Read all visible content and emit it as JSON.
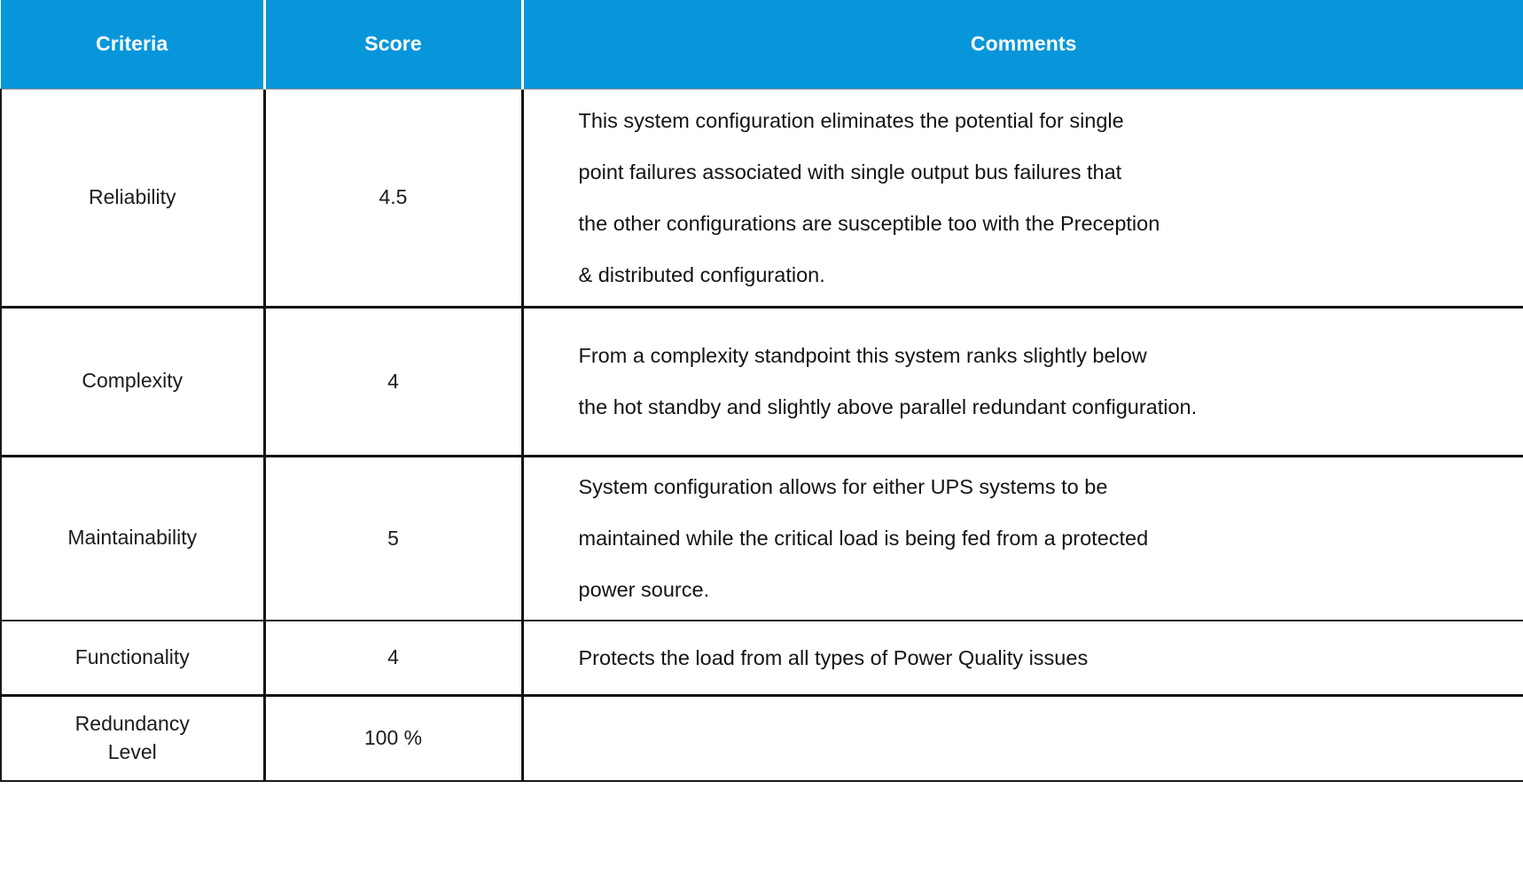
{
  "table": {
    "accent_color": "#0896db",
    "header_text_color": "#ffffff",
    "body_text_color": "#1c1c1c",
    "border_color": "#111111",
    "columns": [
      {
        "key": "criteria",
        "label": "Criteria"
      },
      {
        "key": "score",
        "label": "Score"
      },
      {
        "key": "comments",
        "label": "Comments"
      }
    ],
    "rows": [
      {
        "criteria": "Reliability",
        "criteria_lines": [
          "Reliability"
        ],
        "score": "4.5",
        "comment_lines": [
          "This system configuration eliminates the potential for single",
          "point failures associated with single output bus failures that",
          "the other configurations are susceptible too with the Preception",
          "& distributed configuration."
        ]
      },
      {
        "criteria": "Complexity",
        "criteria_lines": [
          "Complexity"
        ],
        "score": "4",
        "comment_lines": [
          "From a complexity standpoint this system ranks slightly below",
          "the hot standby and slightly above parallel redundant configuration."
        ]
      },
      {
        "criteria": "Maintainability",
        "criteria_lines": [
          "Maintainability"
        ],
        "score": "5",
        "comment_lines": [
          "System configuration allows for either UPS systems to be",
          "maintained while the critical load is being fed from a protected",
          "power source."
        ]
      },
      {
        "criteria": "Functionality",
        "criteria_lines": [
          "Functionality"
        ],
        "score": "4",
        "comment_lines": [
          "Protects the load from all types of Power Quality issues"
        ]
      },
      {
        "criteria": "Redundancy Level",
        "criteria_lines": [
          "Redundancy",
          "Level"
        ],
        "score": "100 %",
        "comment_lines": []
      }
    ]
  }
}
